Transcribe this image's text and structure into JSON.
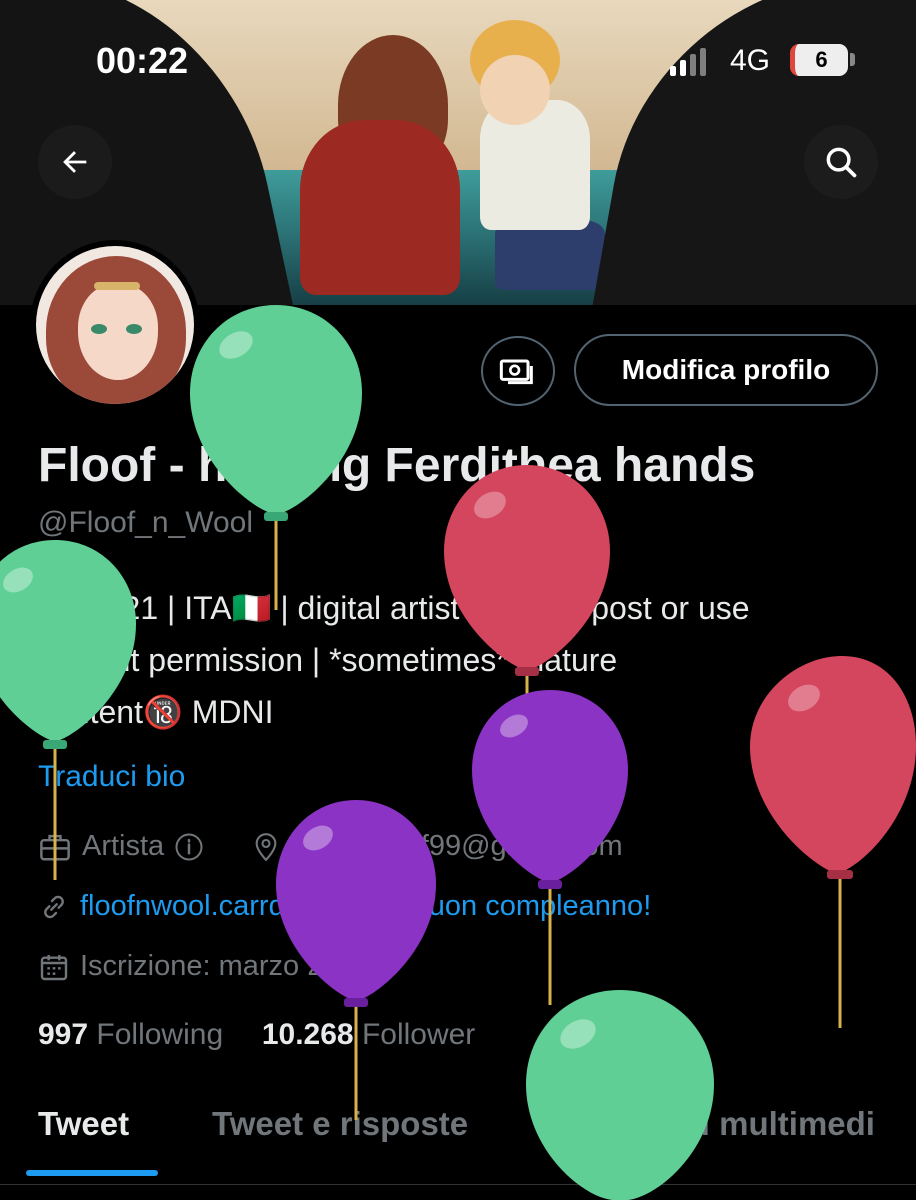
{
  "status_bar": {
    "time": "00:22",
    "network": "4G",
    "battery": "6"
  },
  "header": {
    "back_icon": "arrow-left-icon",
    "search_icon": "search-icon"
  },
  "profile": {
    "tip_icon": "money-icon",
    "edit_button": "Modifica profilo",
    "display_name": "Floof - holding Ferdithea hands",
    "handle": "@Floof_n_Wool",
    "bio_line1": "She +21 | ITA🇮🇹 | digital artist | don't repost or use",
    "bio_line2": "without permission | *sometimes* mature",
    "bio_line3": "content🔞 MDNI",
    "translate_bio": "Traduci bio",
    "category": "Artista",
    "location": "aurorafloof99@gmail.com",
    "website": "floofnwool.carrd.co",
    "birthday": "Buon compleanno!",
    "joined": "Iscrizione: marzo 2018",
    "following_count": "997",
    "following_label": "Following",
    "followers_count": "10.268",
    "followers_label": "Follower"
  },
  "tabs": [
    "Tweet",
    "Tweet e risposte",
    "Contenuti multimedi"
  ],
  "colors": {
    "accent": "#1d9bf0",
    "balloon_green": "#5fcf96",
    "balloon_red": "#d4455e",
    "balloon_purple": "#8a33c4"
  }
}
